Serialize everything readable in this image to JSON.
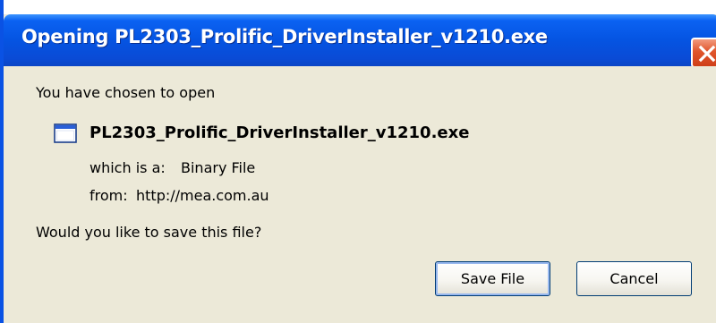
{
  "window": {
    "title": "Opening PL2303_Prolific_DriverInstaller_v1210.exe"
  },
  "dialog": {
    "intro": "You have chosen to open",
    "file_name": "PL2303_Prolific_DriverInstaller_v1210.exe",
    "type_label": "which is a:",
    "type_value": "Binary File",
    "from_label": "from:",
    "from_value": "http://mea.com.au",
    "question": "Would you like to save this file?"
  },
  "buttons": {
    "save_label": "Save File",
    "cancel_label": "Cancel"
  },
  "icons": {
    "close": "close-icon",
    "file": "application-window-icon"
  },
  "colors": {
    "titlebar": "#0554e2",
    "dialog_bg": "#ece9d8",
    "close_button": "#e0552c",
    "button_border": "#003c74"
  }
}
